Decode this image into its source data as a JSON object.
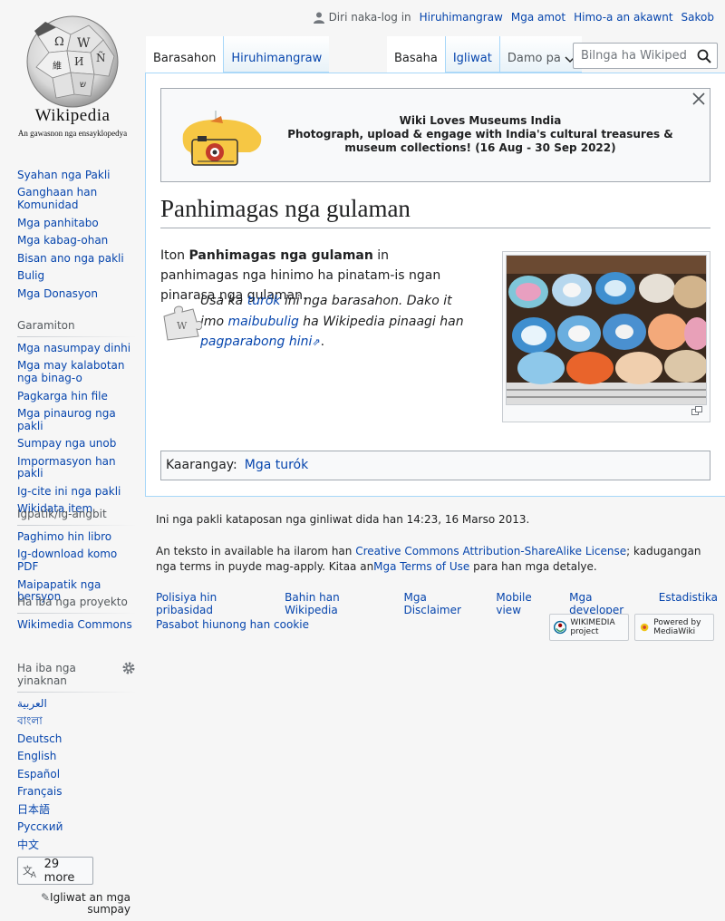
{
  "logo": {
    "wordmark": "Wikipedia",
    "tagline": "An gawasnon nga ensayklopedya"
  },
  "personal": {
    "notlogged": "Diri naka-log in",
    "links": [
      "Hiruhimangraw",
      "Mga amot",
      "Himo-a an akawnt",
      "Sakob"
    ]
  },
  "tabs_left": [
    {
      "label": "Barasahon",
      "selected": true
    },
    {
      "label": "Hiruhimangraw",
      "selected": false
    }
  ],
  "tabs_right": [
    {
      "label": "Basaha",
      "selected": true
    },
    {
      "label": "Igliwat",
      "selected": false
    },
    {
      "label": "Damo pa",
      "selected": false
    }
  ],
  "search": {
    "placeholder": "Bilnga ha Wikipedia"
  },
  "sidebar": {
    "nav": [
      "Syahan nga Pakli",
      "Ganghaan han Komunidad",
      "Mga panhitabo",
      "Mga kabag-ohan",
      "Bisan ano nga pakli",
      "Bulig",
      "Mga Donasyon"
    ],
    "tools_heading": "Garamiton",
    "tools": [
      "Mga nasumpay dinhi",
      "Mga may kalabotan nga binag-o",
      "Pagkarga hin file",
      "Mga pinaurog nga pakli",
      "Sumpay nga unob",
      "Impormasyon han pakli",
      "Ig-cite ini nga pakli",
      "Wikidata item"
    ],
    "print_heading": "Igpatik/ig-angbit",
    "print": [
      "Paghimo hin libro",
      "Ig-download komo PDF",
      "Maipapatik nga bersyon"
    ],
    "other_heading": "Ha iba nga proyekto",
    "other": [
      "Wikimedia Commons"
    ],
    "lang_heading": "Ha iba nga yinaknan",
    "langs": [
      "العربية",
      "বাংলা",
      "Deutsch",
      "English",
      "Español",
      "Français",
      "日本語",
      "Русский",
      "中文"
    ],
    "more_langs": "29 more",
    "edit_links": "Igliwat an mga sumpay"
  },
  "banner": {
    "title": "Wiki Loves Museums India",
    "text": "Photograph, upload & engage with India's cultural treasures & museum collections! (16 Aug - 30 Sep 2022)"
  },
  "article": {
    "title": "Panhimagas nga gulaman",
    "intro_prefix": "Iton ",
    "intro_bold": "Panhimagas nga gulaman",
    "intro_suffix": " in panhimagas nga hinimo ha pinatam-is ngan pinarasa nga gulaman.",
    "stub_1": "Usa ka ",
    "stub_link1": "turók",
    "stub_2": " ini nga barasahon. Dako it imo ",
    "stub_link2": "maibubulig",
    "stub_3": " ha Wikipedia pinaagi han ",
    "stub_link3": "pagparabong hini",
    "stub_4": "."
  },
  "categories": {
    "label": "Kaarangay:",
    "items": [
      "Mga turók"
    ]
  },
  "footer": {
    "lastmod": "Ini nga pakli kataposan nga ginliwat dida han 14:23, 16 Marso 2013.",
    "license_1": "An teksto in available ha ilarom han ",
    "license_link": "Creative Commons Attribution-ShareAlike License",
    "license_2": "; kadugangan nga terms in puyde mag-apply. Kitaa an",
    "terms_link": "Mga Terms of Use",
    "license_3": " para han mga detalye.",
    "places": [
      "Polisiya hin pribasidad",
      "Bahin han Wikipedia",
      "Mga Disclaimer",
      "Mobile view",
      "Mga developer",
      "Estadistika"
    ],
    "cookie": "Pasabot hiunong han cookie",
    "wikimedia_badge": "WIKIMEDIA project",
    "mediawiki_badge": "Powered by MediaWiki"
  },
  "colors": {
    "link": "#0645ad",
    "tab_border": "#a7d7f9",
    "bg": "#f6f6f6"
  }
}
